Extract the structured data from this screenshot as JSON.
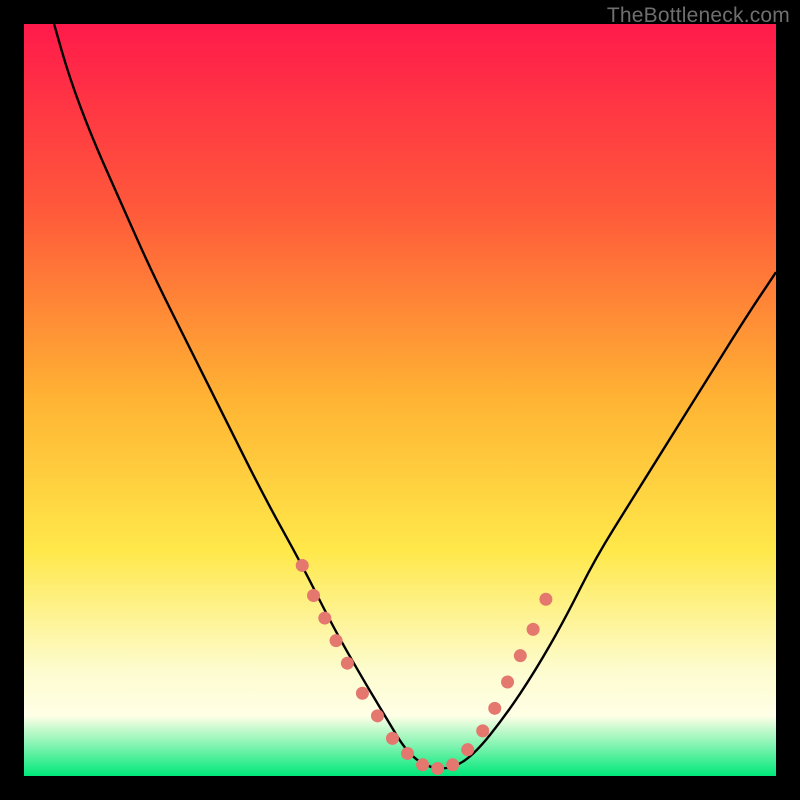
{
  "watermark": "TheBottleneck.com",
  "chart_data": {
    "type": "line",
    "title": "",
    "xlabel": "",
    "ylabel": "",
    "xlim": [
      0,
      100
    ],
    "ylim": [
      0,
      100
    ],
    "grid": false,
    "series": [
      {
        "name": "curve",
        "x": [
          4,
          6,
          9,
          13,
          17,
          22,
          27,
          32,
          37,
          41,
          45,
          48,
          51,
          54,
          57,
          60,
          64,
          68,
          72,
          76,
          81,
          86,
          91,
          96,
          100
        ],
        "y": [
          100,
          93,
          85,
          76,
          67,
          57,
          47,
          37,
          28,
          20,
          13,
          8,
          3,
          1,
          1,
          3,
          8,
          14,
          21,
          29,
          37,
          45,
          53,
          61,
          67
        ]
      },
      {
        "name": "markers",
        "x": [
          37.0,
          38.5,
          40.0,
          41.5,
          43.0,
          45.0,
          47.0,
          49.0,
          51.0,
          53.0,
          55.0,
          57.0,
          59.0,
          61.0,
          62.6,
          64.3,
          66.0,
          67.7,
          69.4
        ],
        "y": [
          28.0,
          24.0,
          21.0,
          18.0,
          15.0,
          11.0,
          8.0,
          5.0,
          3.0,
          1.5,
          1.0,
          1.5,
          3.5,
          6.0,
          9.0,
          12.5,
          16.0,
          19.5,
          23.5
        ]
      }
    ],
    "colors": {
      "curve_stroke": "#000000",
      "marker_fill": "#e4776e"
    }
  }
}
